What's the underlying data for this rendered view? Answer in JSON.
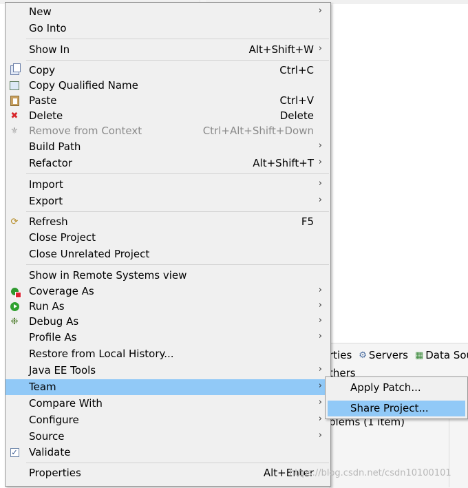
{
  "menu": {
    "items": [
      {
        "label": "New",
        "accel": "",
        "submenu": true,
        "icon": "",
        "disabled": false
      },
      {
        "label": "Go Into",
        "accel": "",
        "submenu": false,
        "icon": "",
        "disabled": false
      },
      {
        "label": "Show In",
        "accel": "Alt+Shift+W",
        "submenu": true,
        "icon": "",
        "disabled": false
      },
      {
        "label": "Copy",
        "accel": "Ctrl+C",
        "submenu": false,
        "icon": "copy-icon",
        "disabled": false
      },
      {
        "label": "Copy Qualified Name",
        "accel": "",
        "submenu": false,
        "icon": "copy-qualified-name-icon",
        "disabled": false
      },
      {
        "label": "Paste",
        "accel": "Ctrl+V",
        "submenu": false,
        "icon": "paste-icon",
        "disabled": false
      },
      {
        "label": "Delete",
        "accel": "Delete",
        "submenu": false,
        "icon": "delete-icon",
        "disabled": false
      },
      {
        "label": "Remove from Context",
        "accel": "Ctrl+Alt+Shift+Down",
        "submenu": false,
        "icon": "remove-from-context-icon",
        "disabled": true
      },
      {
        "label": "Build Path",
        "accel": "",
        "submenu": true,
        "icon": "",
        "disabled": false
      },
      {
        "label": "Refactor",
        "accel": "Alt+Shift+T",
        "submenu": true,
        "icon": "",
        "disabled": false
      },
      {
        "label": "Import",
        "accel": "",
        "submenu": true,
        "icon": "",
        "disabled": false
      },
      {
        "label": "Export",
        "accel": "",
        "submenu": true,
        "icon": "",
        "disabled": false
      },
      {
        "label": "Refresh",
        "accel": "F5",
        "submenu": false,
        "icon": "refresh-icon",
        "disabled": false
      },
      {
        "label": "Close Project",
        "accel": "",
        "submenu": false,
        "icon": "",
        "disabled": false
      },
      {
        "label": "Close Unrelated Project",
        "accel": "",
        "submenu": false,
        "icon": "",
        "disabled": false
      },
      {
        "label": "Show in Remote Systems view",
        "accel": "",
        "submenu": false,
        "icon": "",
        "disabled": false
      },
      {
        "label": "Coverage As",
        "accel": "",
        "submenu": true,
        "icon": "coverage-icon",
        "disabled": false
      },
      {
        "label": "Run As",
        "accel": "",
        "submenu": true,
        "icon": "run-icon",
        "disabled": false
      },
      {
        "label": "Debug As",
        "accel": "",
        "submenu": true,
        "icon": "debug-icon",
        "disabled": false
      },
      {
        "label": "Profile As",
        "accel": "",
        "submenu": true,
        "icon": "",
        "disabled": false
      },
      {
        "label": "Restore from Local History...",
        "accel": "",
        "submenu": false,
        "icon": "",
        "disabled": false
      },
      {
        "label": "Java EE Tools",
        "accel": "",
        "submenu": true,
        "icon": "",
        "disabled": false
      },
      {
        "label": "Team",
        "accel": "",
        "submenu": true,
        "icon": "",
        "disabled": false,
        "highlighted": true
      },
      {
        "label": "Compare With",
        "accel": "",
        "submenu": true,
        "icon": "",
        "disabled": false
      },
      {
        "label": "Configure",
        "accel": "",
        "submenu": true,
        "icon": "",
        "disabled": false
      },
      {
        "label": "Source",
        "accel": "",
        "submenu": true,
        "icon": "",
        "disabled": false
      },
      {
        "label": "Validate",
        "accel": "",
        "submenu": false,
        "icon": "validate-checkbox-icon",
        "disabled": false
      },
      {
        "label": "Properties",
        "accel": "Alt+Enter",
        "submenu": false,
        "icon": "",
        "disabled": false
      }
    ]
  },
  "team_submenu": {
    "items": [
      {
        "label": "Apply Patch..."
      },
      {
        "label": "Share Project...",
        "highlighted": true
      }
    ]
  },
  "background": {
    "tab_fragment": "rties",
    "servers_tab": "Servers",
    "data_source_tab": "Data Sou",
    "others_fragment": "thers",
    "problems_fragment": "blems (1 item)"
  },
  "watermark": "https://blog.csdn.net/csdn10100101",
  "colors": {
    "menu_bg": "#f0f0f0",
    "highlight": "#91c9f7",
    "disabled_text": "#8a8a8a",
    "delete_icon": "#d8262b"
  }
}
